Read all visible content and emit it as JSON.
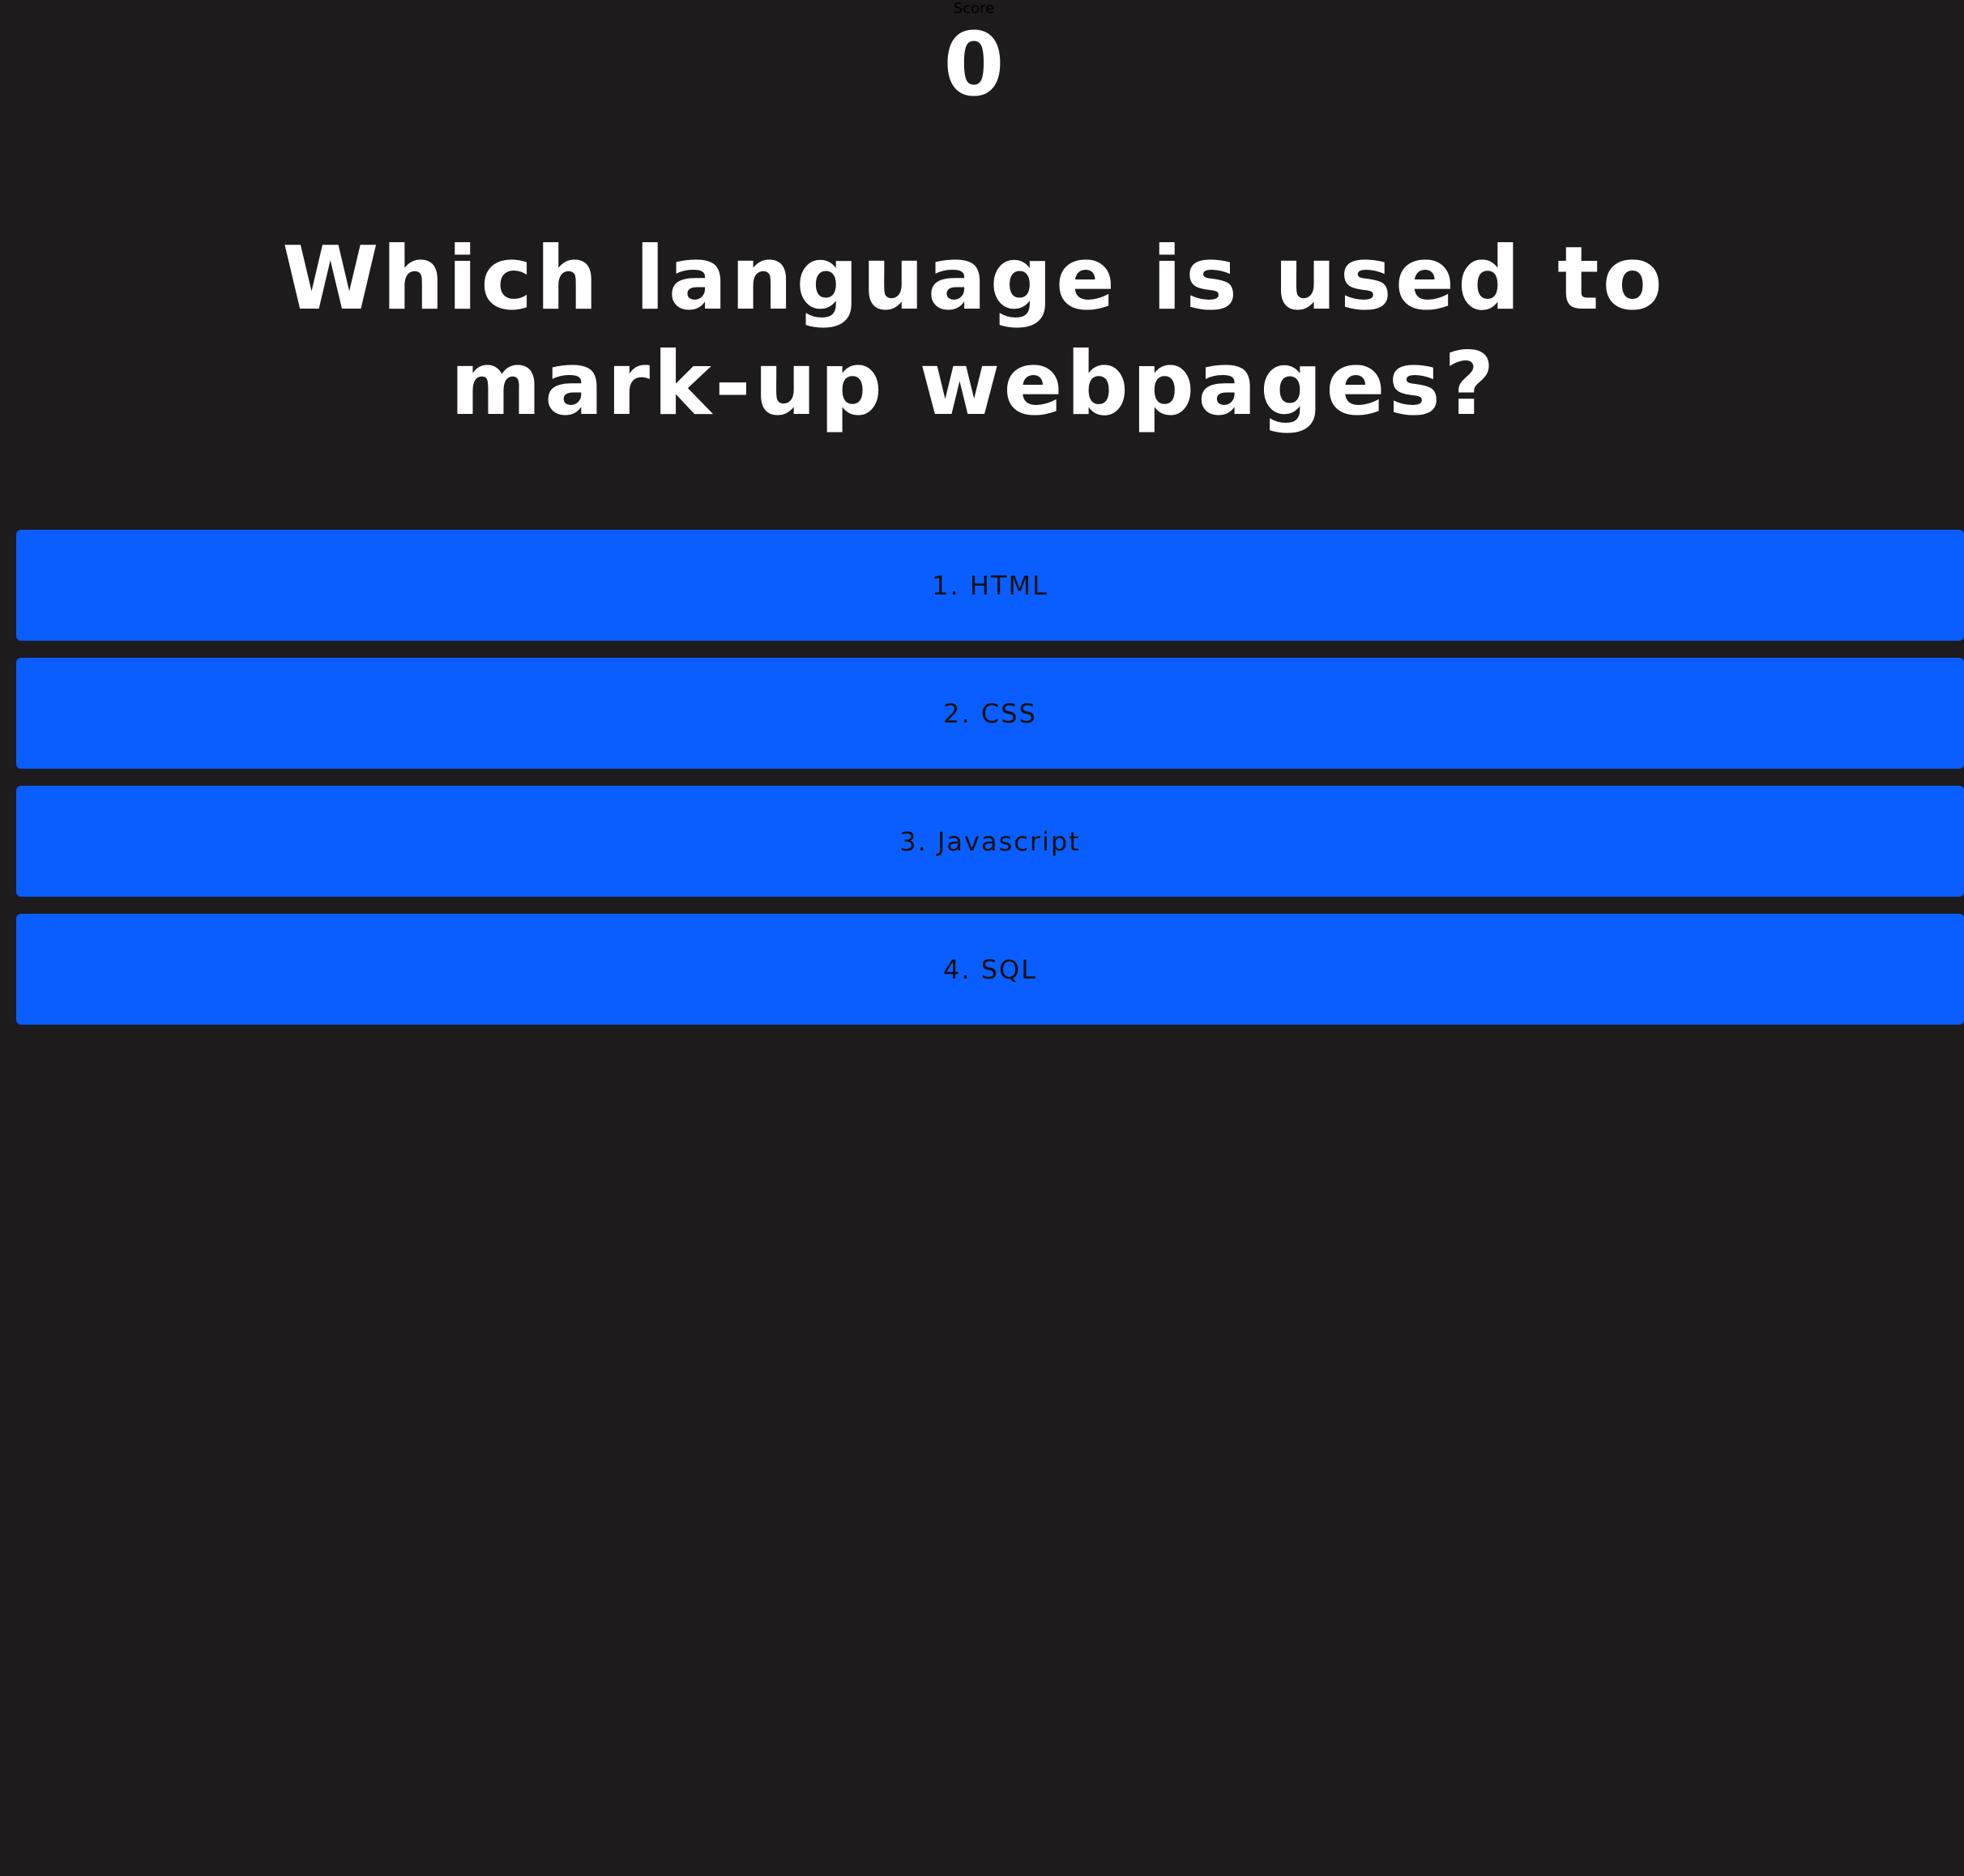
{
  "score": {
    "label": "Score",
    "value": "0"
  },
  "question": {
    "text": "Which language is used to mark-up webpages?"
  },
  "answers": [
    {
      "label": "1. HTML"
    },
    {
      "label": "2. CSS"
    },
    {
      "label": "3. Javascript"
    },
    {
      "label": "4. SQL"
    }
  ],
  "colors": {
    "background": "#1d1b1c",
    "answer_button": "#0a5eff",
    "text_light": "#ffffff",
    "text_dark": "#111111"
  }
}
